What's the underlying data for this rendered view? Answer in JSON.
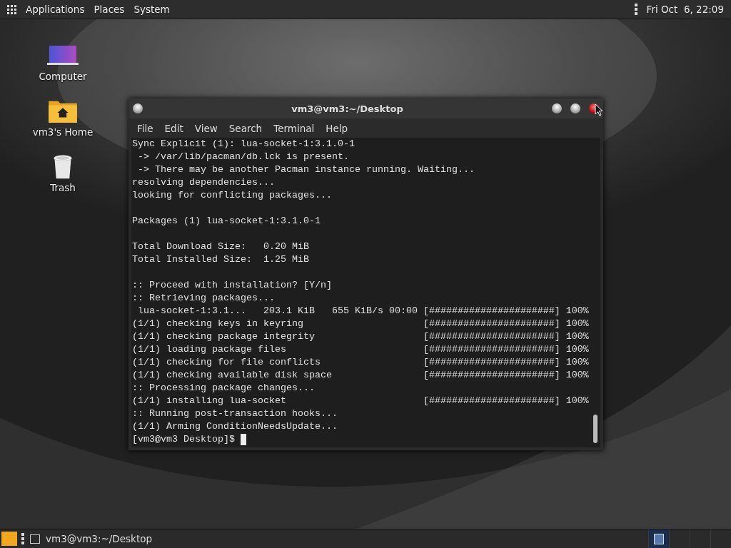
{
  "top_panel": {
    "menus": [
      "Applications",
      "Places",
      "System"
    ],
    "clock": "Fri Oct  6, 22:09"
  },
  "desktop_icons": [
    {
      "kind": "computer",
      "label": "Computer"
    },
    {
      "kind": "home",
      "label": "vm3's Home"
    },
    {
      "kind": "trash",
      "label": "Trash"
    }
  ],
  "terminal_window": {
    "title": "vm3@vm3:~/Desktop",
    "menus": [
      "File",
      "Edit",
      "View",
      "Search",
      "Terminal",
      "Help"
    ],
    "output_blocks": [
      [
        "Sync Explicit (1): lua-socket-1:3.1.0-1",
        " -> /var/lib/pacman/db.lck is present.",
        " -> There may be another Pacman instance running. Waiting...",
        "resolving dependencies...",
        "looking for conflicting packages..."
      ],
      [
        "Packages (1) lua-socket-1:3.1.0-1"
      ],
      [
        "Total Download Size:   0.20 MiB",
        "Total Installed Size:  1.25 MiB"
      ],
      [
        ":: Proceed with installation? [Y/n]",
        ":: Retrieving packages...",
        " lua-socket-1:3.1...   203.1 KiB   655 KiB/s 00:00 [######################] 100%",
        "(1/1) checking keys in keyring                     [######################] 100%",
        "(1/1) checking package integrity                   [######################] 100%",
        "(1/1) loading package files                        [######################] 100%",
        "(1/1) checking for file conflicts                  [######################] 100%",
        "(1/1) checking available disk space                [######################] 100%",
        ":: Processing package changes...",
        "(1/1) installing lua-socket                        [######################] 100%",
        ":: Running post-transaction hooks...",
        "(1/1) Arming ConditionNeedsUpdate..."
      ]
    ],
    "prompt": "[vm3@vm3 Desktop]$ "
  },
  "taskbar": {
    "tasks": [
      {
        "label": "vm3@vm3:~/Desktop",
        "selected": false
      }
    ]
  }
}
